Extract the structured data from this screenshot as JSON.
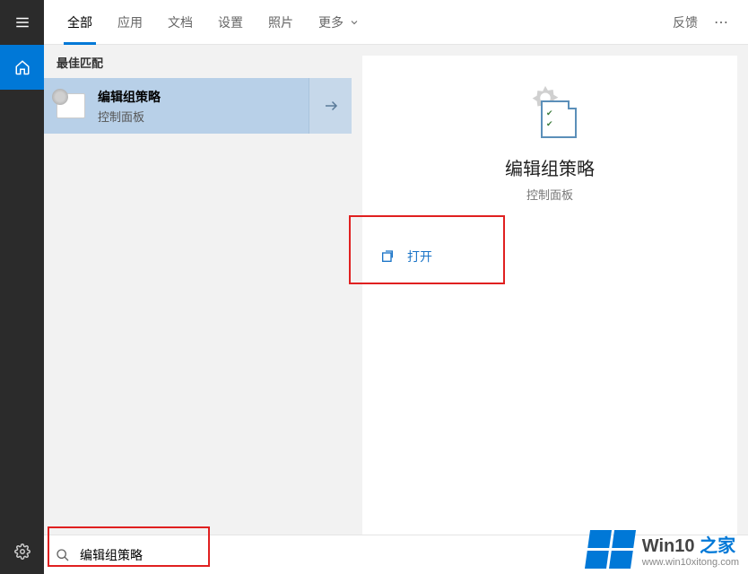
{
  "tabs": {
    "items": [
      "全部",
      "应用",
      "文档",
      "设置",
      "照片",
      "更多"
    ],
    "active_index": 0,
    "feedback": "反馈"
  },
  "left": {
    "section_header": "最佳匹配",
    "result": {
      "title": "编辑组策略",
      "subtitle": "控制面板"
    }
  },
  "detail": {
    "title": "编辑组策略",
    "subtitle": "控制面板",
    "open_label": "打开"
  },
  "search": {
    "value": "编辑组策略",
    "placeholder": ""
  },
  "watermark": {
    "line1_a": "Win10",
    "line1_b": "之家",
    "line2": "www.win10xitong.com"
  }
}
